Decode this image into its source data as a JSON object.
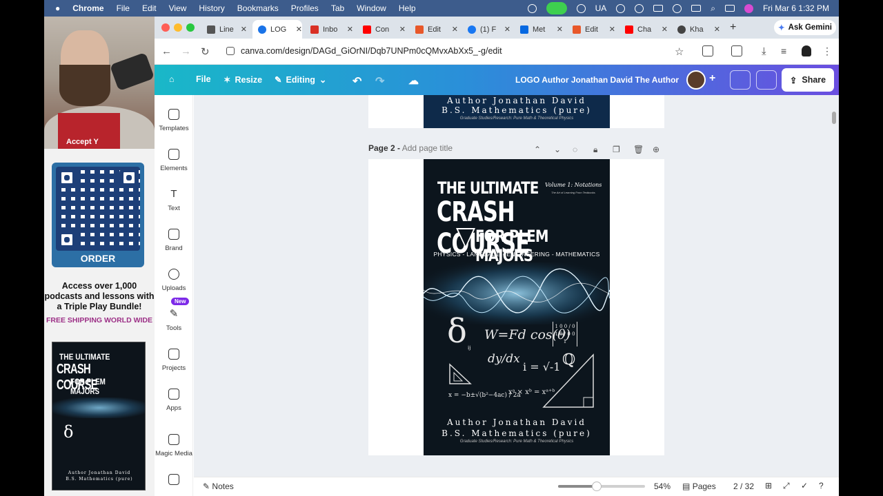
{
  "menubar": {
    "app": "Chrome",
    "items": [
      "File",
      "Edit",
      "View",
      "History",
      "Bookmarks",
      "Profiles",
      "Tab",
      "Window",
      "Help"
    ],
    "input_indicator": "UA",
    "clock": "Fri Mar 6  1:32 PM"
  },
  "overlay": {
    "shirt_text": "Accept Y",
    "qr_label": "ORDER",
    "promo_text": "Access over 1,000 podcasts and lessons with a Triple Play Bundle!",
    "shipping_text": "FREE SHIPPING WORLD WIDE"
  },
  "browser": {
    "tabs": [
      {
        "label": "Line",
        "color": "#555555"
      },
      {
        "label": "LOG",
        "color": "#1a73e8"
      },
      {
        "label": "Inbo",
        "color": "#d93025"
      },
      {
        "label": "Con",
        "color": "#ff0000"
      },
      {
        "label": "Edit",
        "color": "#e8582a"
      },
      {
        "label": "(1) F",
        "color": "#1877f2"
      },
      {
        "label": "Met",
        "color": "#0668e1"
      },
      {
        "label": "Edit",
        "color": "#e8582a"
      },
      {
        "label": "Cha",
        "color": "#ff0000"
      },
      {
        "label": "Kha",
        "color": "#444444"
      }
    ],
    "ask_gemini": "Ask Gemini",
    "url": "canva.com/design/DAGd_GiOrNI/Dqb7UNPm0cQMvxAbXx5_-g/edit"
  },
  "canva": {
    "file": "File",
    "resize": "Resize",
    "editing": "Editing",
    "doc_title": "LOGO Author Jonathan David The Author",
    "share": "Share",
    "sidebar": [
      "Templates",
      "Elements",
      "Text",
      "Brand",
      "Uploads",
      "Tools",
      "Projects",
      "Apps",
      "Magic Media"
    ],
    "new_badge": "New",
    "page2_label": "Page 2 -",
    "page2_title_placeholder": "Add page title",
    "notes": "Notes",
    "zoom": "54%",
    "pages": "Pages",
    "page_count": "2 / 32"
  },
  "cover": {
    "line1": "THE ULTIMATE",
    "volume": "Volume 1: Notations",
    "volume_sub": "The Art of Learning From Textbooks",
    "line2": "CRASH COURSE",
    "line3": "FOR PLEM MAJORS",
    "fields": "PHYSICS - LANGUAGE - ENGINEERING - MATHEMATICS",
    "author": "Author Jonathan David",
    "degree": "B.S. Mathematics (pure)",
    "grad": "Graduate Studies/Research: Pure Math & Theoretical Physics",
    "eq_work": "W=Fd cos(θ)",
    "eq_delta": "δ",
    "eq_delta_sub": "ij",
    "eq_deriv": "dy/dx",
    "eq_i": "i = √-1",
    "eq_Q": "ℚ",
    "eq_quad": "x = −b±√(b²−4ac) / 2a",
    "eq_exp": "xᵃ × xᵇ = xᵃ⁺ᵇ",
    "matrix": "1 0 0 / 0 1 0 / 0 0 1"
  }
}
